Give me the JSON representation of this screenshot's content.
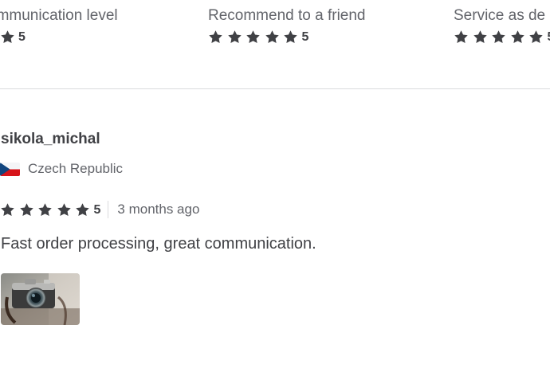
{
  "sub_ratings": [
    {
      "label": "ommunication level",
      "score": "5",
      "stars": 5
    },
    {
      "label": "Recommend to a friend",
      "score": "5",
      "stars": 5
    },
    {
      "label": "Service as de",
      "score": "5",
      "stars": 5
    }
  ],
  "review": {
    "username": "sikola_michal",
    "country": "Czech Republic",
    "flag_icon": "czech-flag-icon",
    "rating": {
      "score": "5",
      "stars": 5
    },
    "time_ago": "3 months ago",
    "text": "Fast order processing, great communication.",
    "attachment_icon": "camera-photo-thumbnail"
  },
  "colors": {
    "star": "#404145",
    "text": "#404145",
    "muted": "#62646a",
    "divider": "#dadbdd"
  }
}
